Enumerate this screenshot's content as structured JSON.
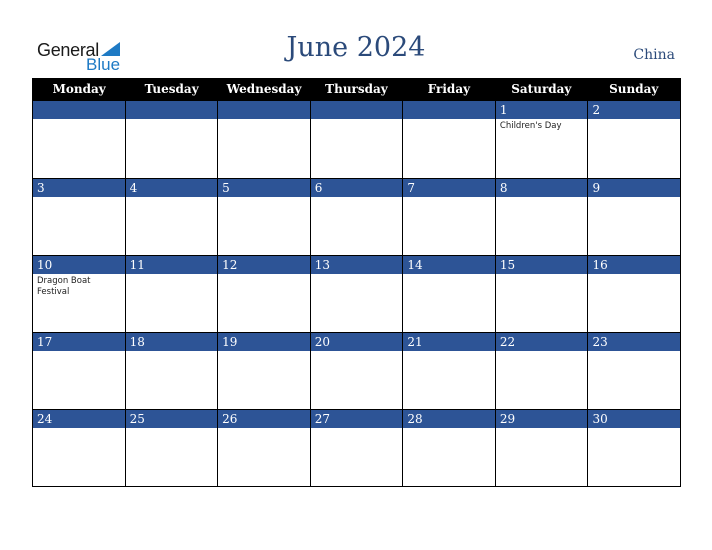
{
  "logo": {
    "word1": "General",
    "word2": "Blue"
  },
  "header": {
    "title": "June 2024",
    "country": "China"
  },
  "colors": {
    "band": "#2d5496",
    "title": "#2b4a7a",
    "logo_blue": "#1e7ac4"
  },
  "days": [
    "Monday",
    "Tuesday",
    "Wednesday",
    "Thursday",
    "Friday",
    "Saturday",
    "Sunday"
  ],
  "weeks": [
    [
      {
        "d": ""
      },
      {
        "d": ""
      },
      {
        "d": ""
      },
      {
        "d": ""
      },
      {
        "d": ""
      },
      {
        "d": "1",
        "e": "Children's Day"
      },
      {
        "d": "2"
      }
    ],
    [
      {
        "d": "3"
      },
      {
        "d": "4"
      },
      {
        "d": "5"
      },
      {
        "d": "6"
      },
      {
        "d": "7"
      },
      {
        "d": "8"
      },
      {
        "d": "9"
      }
    ],
    [
      {
        "d": "10",
        "e": "Dragon Boat Festival"
      },
      {
        "d": "11"
      },
      {
        "d": "12"
      },
      {
        "d": "13"
      },
      {
        "d": "14"
      },
      {
        "d": "15"
      },
      {
        "d": "16"
      }
    ],
    [
      {
        "d": "17"
      },
      {
        "d": "18"
      },
      {
        "d": "19"
      },
      {
        "d": "20"
      },
      {
        "d": "21"
      },
      {
        "d": "22"
      },
      {
        "d": "23"
      }
    ],
    [
      {
        "d": "24"
      },
      {
        "d": "25"
      },
      {
        "d": "26"
      },
      {
        "d": "27"
      },
      {
        "d": "28"
      },
      {
        "d": "29"
      },
      {
        "d": "30"
      }
    ]
  ]
}
